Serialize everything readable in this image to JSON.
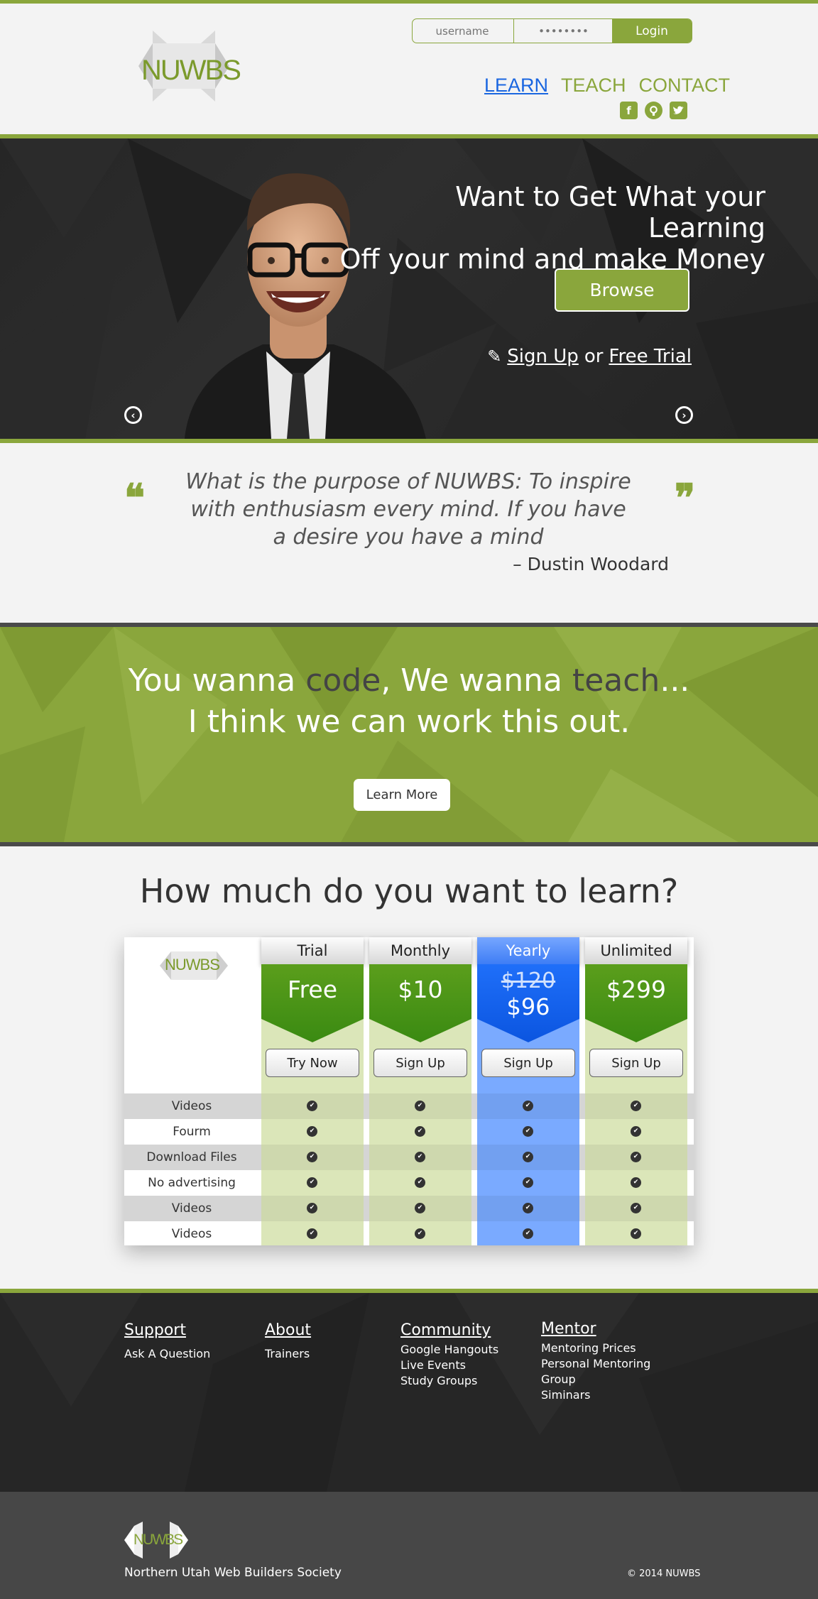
{
  "header": {
    "logo_text": "NUWBS",
    "login": {
      "username_placeholder": "username",
      "password_placeholder": "••••••••",
      "login_label": "Login"
    },
    "nav": [
      {
        "label": "LEARN"
      },
      {
        "label": "TEACH"
      },
      {
        "label": "CONTACT"
      }
    ],
    "social_icons": [
      "facebook-icon",
      "github-icon",
      "twitter-icon"
    ]
  },
  "hero": {
    "title_line1": "Want to Get What your Learning",
    "title_line2": "Off your mind and make Money",
    "browse_label": "Browse",
    "signup_label": "Sign Up",
    "or_label": "or",
    "trial_label": "Free Trial"
  },
  "quote": {
    "text": "What is the purpose of NUWBS: To inspire with enthusiasm every mind.  If you have a desire you have a mind",
    "author": "– Dustin Woodard"
  },
  "banner": {
    "part1": "You wanna ",
    "code": "code",
    "part2": ", We wanna ",
    "teach": "teach",
    "part3": "...",
    "line2": "I think we can work this out.",
    "button": "Learn More"
  },
  "pricing": {
    "title": "How much do you want to learn?",
    "logo_text": "NUWBS",
    "plans": [
      {
        "name": "Trial",
        "price": "Free",
        "button": "Try Now"
      },
      {
        "name": "Monthly",
        "price": "$10",
        "button": "Sign Up"
      },
      {
        "name": "Yearly",
        "old_price": "$120",
        "price": "$96",
        "button": "Sign Up"
      },
      {
        "name": "Unlimited",
        "price": "$299",
        "button": "Sign Up"
      }
    ],
    "features": [
      "Videos",
      "Fourm",
      "Download Files",
      "No advertising",
      "Videos",
      "Videos"
    ]
  },
  "footer": {
    "columns": [
      {
        "heading": "Support",
        "items": [
          "Ask A Question"
        ]
      },
      {
        "heading": "About",
        "items": [
          "Trainers"
        ]
      },
      {
        "heading": "Community",
        "items": [
          "Google Hangouts",
          "Live Events",
          "Study Groups"
        ]
      },
      {
        "heading": "Mentor",
        "items": [
          "Mentoring Prices",
          "Personal Mentoring",
          "Group",
          "Siminars"
        ]
      }
    ],
    "logo_text": "NUWBS",
    "society": "Northern Utah Web Builders Society",
    "copyright": "© 2014 NUWBS"
  },
  "colors": {
    "accent": "#8aa63c",
    "dark": "#262626",
    "highlight_blue": "#1f6ff9"
  }
}
